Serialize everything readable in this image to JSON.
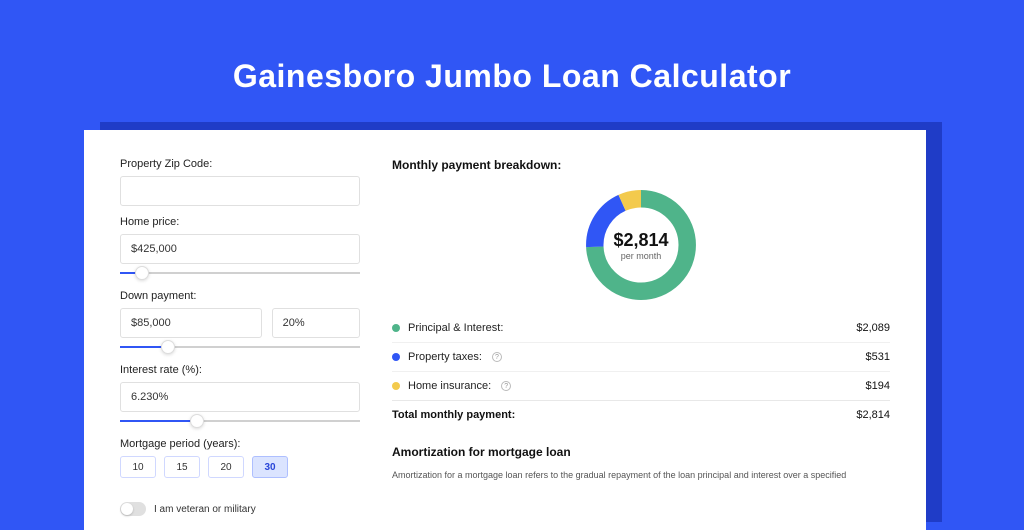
{
  "title": "Gainesboro Jumbo Loan Calculator",
  "form": {
    "zip": {
      "label": "Property Zip Code:",
      "value": ""
    },
    "price": {
      "label": "Home price:",
      "value": "$425,000",
      "slider_pct": 9
    },
    "down": {
      "label": "Down payment:",
      "amount": "$85,000",
      "pct": "20%",
      "slider_pct": 20
    },
    "rate": {
      "label": "Interest rate (%):",
      "value": "6.230%",
      "slider_pct": 32
    },
    "period": {
      "label": "Mortgage period (years):",
      "options": [
        "10",
        "15",
        "20",
        "30"
      ],
      "active": 3
    },
    "veteran": {
      "label": "I am veteran or military",
      "on": false
    }
  },
  "breakdown": {
    "title": "Monthly payment breakdown:",
    "center_amount": "$2,814",
    "center_sub": "per month",
    "items": [
      {
        "label": "Principal & Interest:",
        "value": "$2,089",
        "color": "#4fb48a",
        "info": false
      },
      {
        "label": "Property taxes:",
        "value": "$531",
        "color": "#3056f5",
        "info": true
      },
      {
        "label": "Home insurance:",
        "value": "$194",
        "color": "#f3ca4d",
        "info": true
      }
    ],
    "total": {
      "label": "Total monthly payment:",
      "value": "$2,814"
    }
  },
  "amortization": {
    "title": "Amortization for mortgage loan",
    "text": "Amortization for a mortgage loan refers to the gradual repayment of the loan principal and interest over a specified"
  },
  "chart_data": {
    "type": "pie",
    "title": "Monthly payment breakdown",
    "series": [
      {
        "name": "Principal & Interest",
        "value": 2089,
        "color": "#4fb48a"
      },
      {
        "name": "Property taxes",
        "value": 531,
        "color": "#3056f5"
      },
      {
        "name": "Home insurance",
        "value": 194,
        "color": "#f3ca4d"
      }
    ],
    "total": 2814,
    "center_label": "$2,814 per month"
  }
}
